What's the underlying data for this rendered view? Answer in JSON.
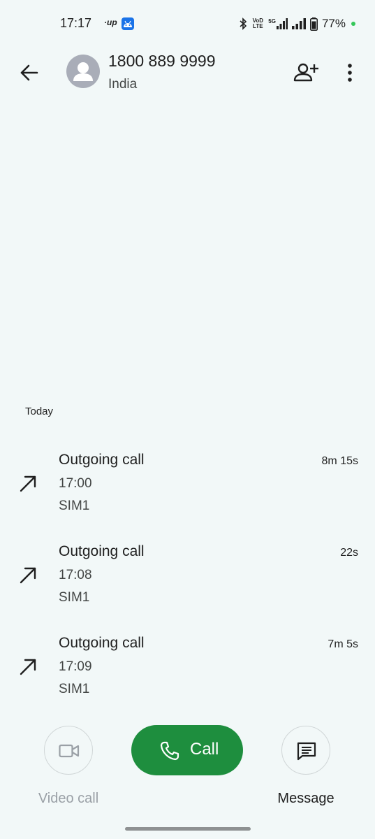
{
  "status_bar": {
    "time": "17:17",
    "up_label": "·up",
    "volte_line1": "VoD",
    "volte_line2": "LTE",
    "network_label": "5G",
    "battery_percent": "77%",
    "icons": [
      "bluetooth-icon",
      "signal-icon",
      "signal-icon",
      "battery-icon"
    ],
    "indicator_color": "#34c759"
  },
  "header": {
    "contact_number": "1800 889 9999",
    "contact_location": "India",
    "icons": [
      "back-arrow-icon",
      "person-icon",
      "add-person-icon",
      "more-vert-icon"
    ]
  },
  "history": {
    "section_label": "Today",
    "calls": [
      {
        "type": "Outgoing call",
        "time": "17:00",
        "sim": "SIM1",
        "duration": "8m 15s"
      },
      {
        "type": "Outgoing call",
        "time": "17:08",
        "sim": "SIM1",
        "duration": "22s"
      },
      {
        "type": "Outgoing call",
        "time": "17:09",
        "sim": "SIM1",
        "duration": "7m 5s"
      }
    ]
  },
  "actions": {
    "video_call_label": "Video call",
    "call_label": "Call",
    "message_label": "Message",
    "call_color": "#1e8e3e"
  }
}
